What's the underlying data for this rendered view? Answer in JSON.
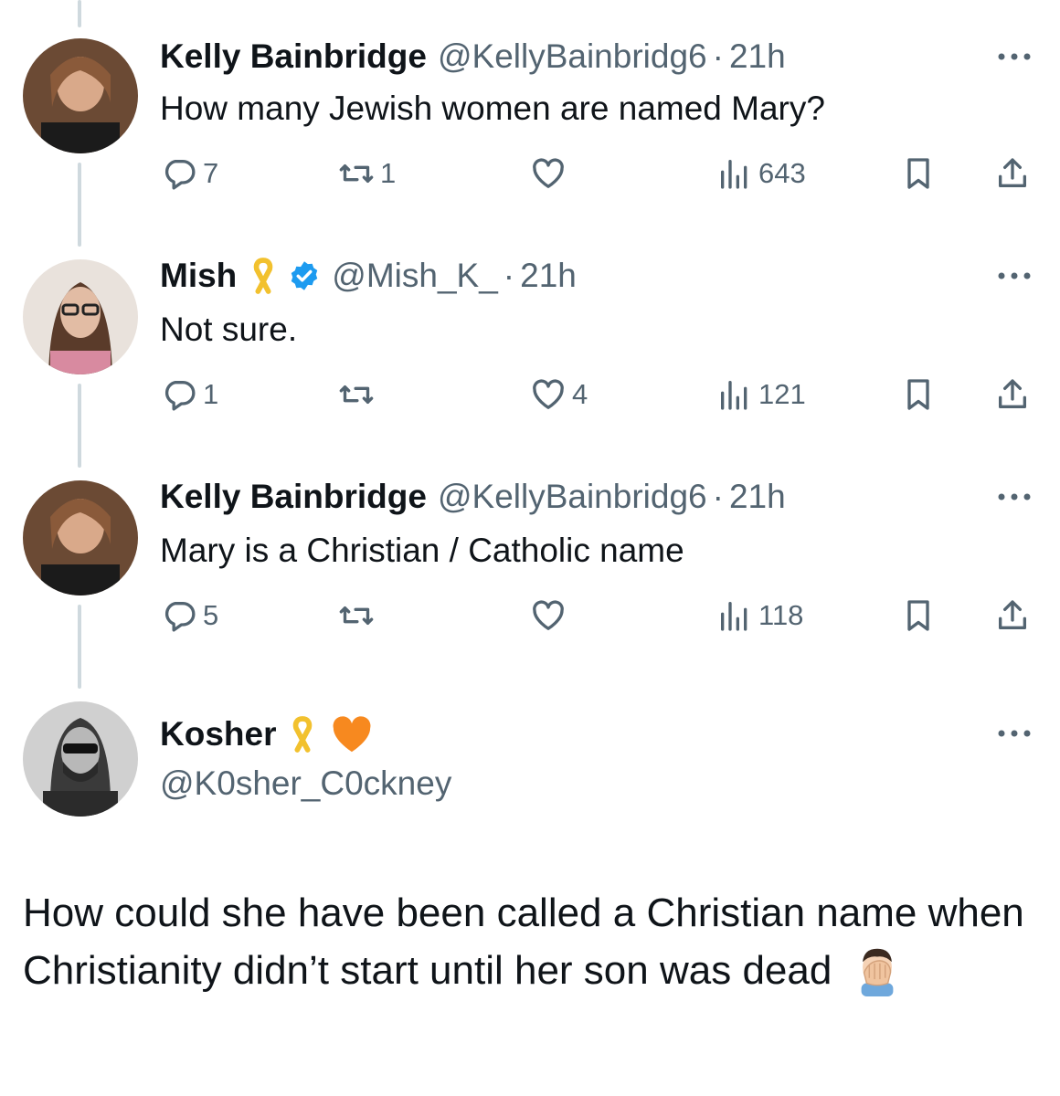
{
  "colors": {
    "text": "#0f1419",
    "secondary": "#536471",
    "thread_line": "#cfd9de",
    "verified": "#1d9bf0",
    "ribbon": "#f2c12e",
    "heart_emoji": "#f7891f"
  },
  "thread": [
    {
      "name": "Kelly Bainbridge",
      "handle": "@KellyBainbridg6",
      "separator": "·",
      "time": "21h",
      "text": "How many Jewish women are named Mary?",
      "replies": "7",
      "reposts": "1",
      "likes": "",
      "views": "643",
      "icons": [
        "reply-icon",
        "repost-icon",
        "like-icon",
        "views-icon",
        "bookmark-icon",
        "share-icon",
        "more-icon"
      ]
    },
    {
      "name": "Mish",
      "handle": "@Mish_K_",
      "separator": "·",
      "time": "21h",
      "text": "Not sure.",
      "replies": "1",
      "reposts": "",
      "likes": "4",
      "views": "121",
      "badges": [
        "yellow-ribbon-icon",
        "verified-badge-icon"
      ]
    },
    {
      "name": "Kelly Bainbridge",
      "handle": "@KellyBainbridg6",
      "separator": "·",
      "time": "21h",
      "text": "Mary is a Christian / Catholic name",
      "replies": "5",
      "reposts": "",
      "likes": "",
      "views": "118"
    }
  ],
  "main_post": {
    "name": "Kosher",
    "handle": "@K0sher_C0ckney",
    "badges": [
      "yellow-ribbon-icon",
      "orange-heart-icon"
    ],
    "text": "How could she have been called a Christian name when Christianity didn’t start until her son was dead",
    "emoji": "man-facepalming-emoji"
  }
}
